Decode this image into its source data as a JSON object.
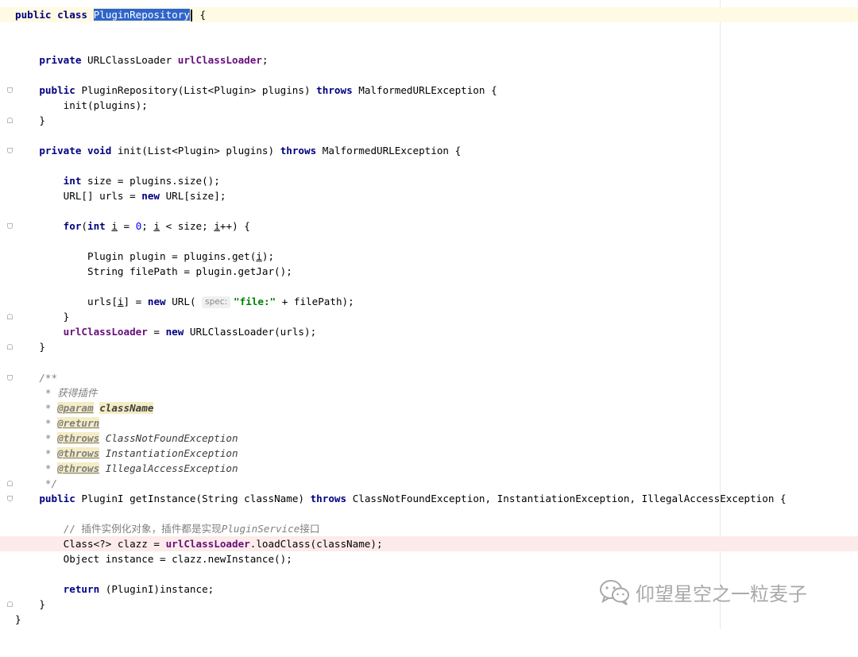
{
  "code_lines": [
    {
      "indent": 0,
      "text": "",
      "fold": null
    },
    {
      "indent": 0,
      "text": "",
      "fold": null
    },
    {
      "indent": 0,
      "text": "",
      "fold": null
    },
    {
      "indent": 4,
      "text": "",
      "fold": null
    },
    {
      "indent": 0,
      "text": "",
      "fold": null
    },
    {
      "indent": 4,
      "text": "",
      "fold": "open"
    },
    {
      "indent": 8,
      "text": "",
      "fold": null
    },
    {
      "indent": 4,
      "text": "",
      "fold": "close"
    },
    {
      "indent": 0,
      "text": "",
      "fold": null
    },
    {
      "indent": 4,
      "text": "",
      "fold": "open"
    },
    {
      "indent": 0,
      "text": "",
      "fold": null
    },
    {
      "indent": 8,
      "text": "",
      "fold": null
    },
    {
      "indent": 8,
      "text": "",
      "fold": null
    },
    {
      "indent": 0,
      "text": "",
      "fold": null
    },
    {
      "indent": 8,
      "text": "",
      "fold": "open"
    },
    {
      "indent": 0,
      "text": "",
      "fold": null
    },
    {
      "indent": 12,
      "text": "",
      "fold": null
    },
    {
      "indent": 12,
      "text": "",
      "fold": null
    },
    {
      "indent": 0,
      "text": "",
      "fold": null
    },
    {
      "indent": 12,
      "text": "",
      "fold": null
    },
    {
      "indent": 8,
      "text": "",
      "fold": "close"
    },
    {
      "indent": 8,
      "text": "",
      "fold": null
    },
    {
      "indent": 4,
      "text": "",
      "fold": "close"
    },
    {
      "indent": 0,
      "text": "",
      "fold": null
    },
    {
      "indent": 4,
      "text": "",
      "fold": "open"
    },
    {
      "indent": 5,
      "text": "",
      "fold": null
    },
    {
      "indent": 5,
      "text": "",
      "fold": null
    },
    {
      "indent": 5,
      "text": "",
      "fold": null
    },
    {
      "indent": 5,
      "text": "",
      "fold": null
    },
    {
      "indent": 5,
      "text": "",
      "fold": null
    },
    {
      "indent": 5,
      "text": "",
      "fold": null
    },
    {
      "indent": 5,
      "text": "",
      "fold": "close"
    },
    {
      "indent": 4,
      "text": "",
      "fold": "open"
    },
    {
      "indent": 0,
      "text": "",
      "fold": null
    },
    {
      "indent": 8,
      "text": "",
      "fold": null
    },
    {
      "indent": 8,
      "text": "",
      "fold": null
    },
    {
      "indent": 8,
      "text": "",
      "fold": null
    },
    {
      "indent": 0,
      "text": "",
      "fold": null
    },
    {
      "indent": 8,
      "text": "",
      "fold": null
    },
    {
      "indent": 4,
      "text": "",
      "fold": "close"
    },
    {
      "indent": 0,
      "text": "",
      "fold": null
    }
  ],
  "tokens": {
    "public": "public",
    "class": "class",
    "class_name": "PluginRepository",
    "brace_open": " {",
    "private": "private",
    "url_class_loader_type": "URLClassLoader",
    "url_class_loader_field": "urlClassLoader",
    "semicolon": ";",
    "constructor_sig": "PluginRepository(List<Plugin> plugins)",
    "throws": "throws",
    "malformed": "MalformedURLException",
    "init_call": "init(plugins);",
    "brace_close": "}",
    "void": "void",
    "init_sig": "init(List<Plugin> plugins)",
    "int": "int",
    "size_decl": "size = plugins.size();",
    "urls_decl_a": "URL[] urls = ",
    "new": "new",
    "urls_decl_b": "URL[size];",
    "for": "for",
    "for_open": "(",
    "for_i": "i",
    "for_eq": " = ",
    "zero": "0",
    "for_mid": "; ",
    "for_lt": " < size; ",
    "for_inc": "++) {",
    "plugin_decl_a": "Plugin plugin = plugins.get(",
    "plugin_decl_b": ");",
    "filepath_decl": "String filePath = plugin.getJar();",
    "urls_assign_a": "urls[",
    "urls_assign_b": "] = ",
    "url_ctor": "URL(",
    "hint_spec": "spec:",
    "str_file": "\"file:\"",
    "urls_assign_c": " + filePath);",
    "loader_assign_eq": " = ",
    "loader_assign_b": "URLClassLoader(urls);",
    "doc_open": "/**",
    "doc_desc": "* 获得插件",
    "doc_star": "* ",
    "doc_param": "@param",
    "doc_classname": "className",
    "doc_return": "@return",
    "doc_throws": "@throws",
    "doc_cnfe": "ClassNotFoundException",
    "doc_ie": "InstantiationException",
    "doc_iae": "IllegalAccessException",
    "doc_close": "*/",
    "plugini_type": "PluginI",
    "get_instance_sig": "getInstance(String className)",
    "get_instance_exc": "ClassNotFoundException, InstantiationException, IllegalAccessException {",
    "comment_a": "// 插件实例化对象，插件都是实现",
    "comment_b": "PluginService",
    "comment_c": "接口",
    "clazz_decl": "Class<?> clazz = ",
    "clazz_decl_b": ".loadClass(className);",
    "instance_decl": "Object instance = clazz.newInstance();",
    "return": "return",
    "return_expr": "(PluginI)instance;"
  },
  "watermark": {
    "text": "仰望星空之一粒麦子",
    "icon": "wechat-icon"
  },
  "colors": {
    "keyword": "#000080",
    "field": "#660e7a",
    "number": "#0000ff",
    "string": "#008000",
    "comment": "#808080",
    "selection": "#2f65ca",
    "caret_line": "#fffae3",
    "error_line": "#fcebea"
  }
}
